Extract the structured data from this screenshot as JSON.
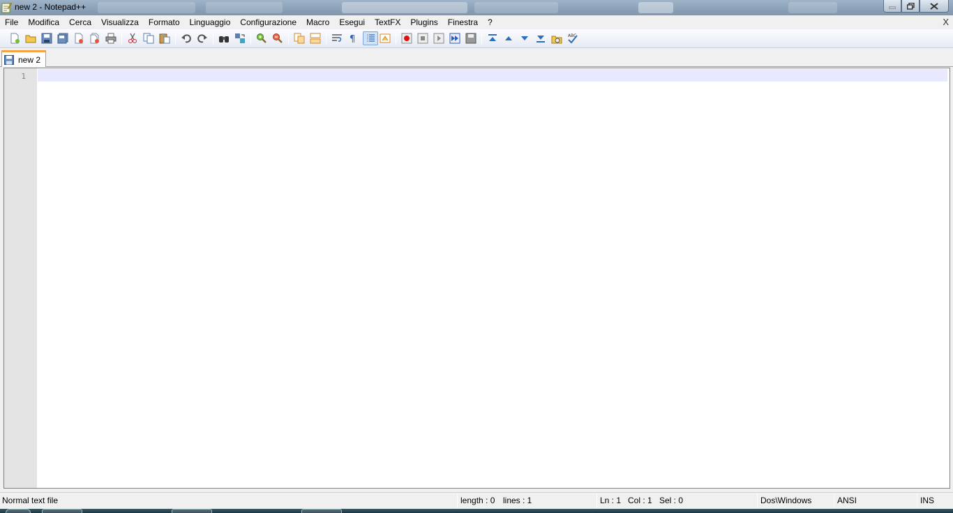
{
  "window": {
    "title": "new  2 - Notepad++"
  },
  "menubar": {
    "items": [
      "File",
      "Modifica",
      "Cerca",
      "Visualizza",
      "Formato",
      "Linguaggio",
      "Configurazione",
      "Macro",
      "Esegui",
      "TextFX",
      "Plugins",
      "Finestra",
      "?"
    ],
    "close_label": "X"
  },
  "toolbar": {
    "buttons": [
      {
        "name": "new-file-icon"
      },
      {
        "name": "open-file-icon"
      },
      {
        "name": "save-icon"
      },
      {
        "name": "save-all-icon"
      },
      {
        "name": "close-file-icon"
      },
      {
        "name": "close-all-icon"
      },
      {
        "name": "print-icon"
      },
      {
        "name": "cut-icon"
      },
      {
        "name": "copy-icon"
      },
      {
        "name": "paste-icon"
      },
      {
        "name": "undo-icon"
      },
      {
        "name": "redo-icon"
      },
      {
        "name": "find-icon"
      },
      {
        "name": "replace-icon"
      },
      {
        "name": "zoom-in-icon"
      },
      {
        "name": "zoom-out-icon"
      },
      {
        "name": "sync-vertical-icon"
      },
      {
        "name": "sync-horizontal-icon"
      },
      {
        "name": "word-wrap-icon"
      },
      {
        "name": "show-all-chars-icon"
      },
      {
        "name": "indent-guide-icon",
        "active": true
      },
      {
        "name": "user-lang-icon"
      },
      {
        "name": "record-macro-icon"
      },
      {
        "name": "stop-macro-icon"
      },
      {
        "name": "play-macro-icon"
      },
      {
        "name": "play-multiple-macro-icon"
      },
      {
        "name": "save-macro-icon"
      },
      {
        "name": "textfx-up-icon"
      },
      {
        "name": "textfx-triangle-up-icon"
      },
      {
        "name": "textfx-triangle-down-icon"
      },
      {
        "name": "textfx-down-icon"
      },
      {
        "name": "textfx-folder-icon"
      },
      {
        "name": "spell-check-icon"
      }
    ],
    "accent": "#316ac5"
  },
  "tabs": [
    {
      "label": "new  2",
      "active": true
    }
  ],
  "editor": {
    "line_numbers": [
      "1"
    ],
    "content": ""
  },
  "statusbar": {
    "file_type": "Normal text file",
    "length": "length : 0",
    "lines": "lines : 1",
    "ln": "Ln : 1",
    "col": "Col : 1",
    "sel": "Sel : 0",
    "eol": "Dos\\Windows",
    "encoding": "ANSI",
    "mode": "INS"
  },
  "colors": {
    "tab_accent": "#f6a340",
    "current_line": "#e8e8ff",
    "gutter": "#e4e4e4"
  }
}
